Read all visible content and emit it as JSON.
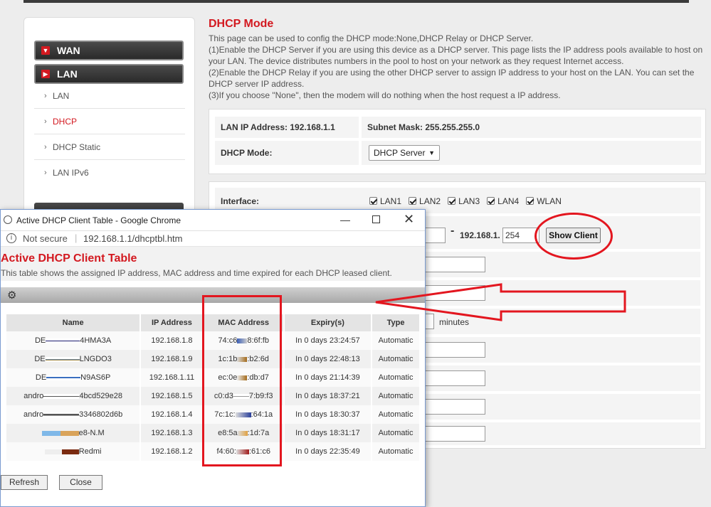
{
  "sidebar": {
    "wan_label": "WAN",
    "lan_label": "LAN",
    "items": [
      {
        "label": "LAN"
      },
      {
        "label": "DHCP"
      },
      {
        "label": "DHCP Static"
      },
      {
        "label": "LAN IPv6"
      }
    ]
  },
  "main": {
    "title": "DHCP Mode",
    "desc": [
      "This page can be used to config the DHCP mode:None,DHCP Relay or DHCP Server.",
      "(1)Enable the DHCP Server if you are using this device as a DHCP server. This page lists the IP address pools available to host on your LAN. The device distributes numbers in the pool to host on your network as they request Internet access.",
      "(2)Enable the DHCP Relay if you are using the other DHCP server to assign IP address to your host on the LAN. You can set the DHCP server IP address.",
      "(3)If you choose \"None\", then the modem will do nothing when the host request a IP address."
    ],
    "lan_ip": "LAN IP Address: 192.168.1.1",
    "subnet": "Subnet Mask: 255.255.255.0",
    "mode_label": "DHCP Mode:",
    "mode_value": "DHCP Server",
    "interface_label": "Interface:",
    "interfaces": [
      "LAN1",
      "LAN2",
      "LAN3",
      "LAN4",
      "WLAN"
    ],
    "range_prefix": "192.168.1.",
    "range_end": "254",
    "show_client": "Show Client",
    "minutes": "minutes"
  },
  "popup": {
    "window_title": "Active DHCP Client Table - Google Chrome",
    "not_secure": "Not secure",
    "url": "192.168.1.1/dhcptbl.htm",
    "title": "Active DHCP Client Table",
    "desc": "This table shows the assigned IP address, MAC address and time expired for each DHCP leased client.",
    "headers": [
      "Name",
      "IP Address",
      "MAC Address",
      "Expiry(s)",
      "Type"
    ],
    "rows": [
      {
        "name_a": "DE",
        "name_b": "4HMA3A",
        "ip": "192.168.1.8",
        "mac_a": "74:c6",
        "mac_b": "8:6f:fb",
        "expiry": "In 0 days 23:24:57",
        "type": "Automatic"
      },
      {
        "name_a": "DE",
        "name_b": "LNGDO3",
        "ip": "192.168.1.9",
        "mac_a": "1c:1b",
        "mac_b": ":b2:6d",
        "expiry": "In 0 days 22:48:13",
        "type": "Automatic"
      },
      {
        "name_a": "DE",
        "name_b": "N9AS6P",
        "ip": "192.168.1.11",
        "mac_a": "ec:0e",
        "mac_b": ":db:d7",
        "expiry": "In 0 days 21:14:39",
        "type": "Automatic"
      },
      {
        "name_a": "andro",
        "name_b": "4bcd529e28",
        "ip": "192.168.1.5",
        "mac_a": "c0:d3",
        "mac_b": "7:b9:f3",
        "expiry": "In 0 days 18:37:21",
        "type": "Automatic"
      },
      {
        "name_a": "andro",
        "name_b": "3346802d6b",
        "ip": "192.168.1.4",
        "mac_a": "7c:1c:",
        "mac_b": ":64:1a",
        "expiry": "In 0 days 18:30:37",
        "type": "Automatic"
      },
      {
        "name_a": "",
        "name_b": "e8-N.M",
        "ip": "192.168.1.3",
        "mac_a": "e8:5a",
        "mac_b": ":1d:7a",
        "expiry": "In 0 days 18:31:17",
        "type": "Automatic"
      },
      {
        "name_a": "",
        "name_b": "Redmi",
        "ip": "192.168.1.2",
        "mac_a": "f4:60:",
        "mac_b": ":61:c6",
        "expiry": "In 0 days 22:35:49",
        "type": "Automatic"
      }
    ],
    "refresh": "Refresh",
    "close": "Close"
  },
  "colors": {
    "accent_red": "#d31920",
    "annotation_red": "#e3161f"
  }
}
